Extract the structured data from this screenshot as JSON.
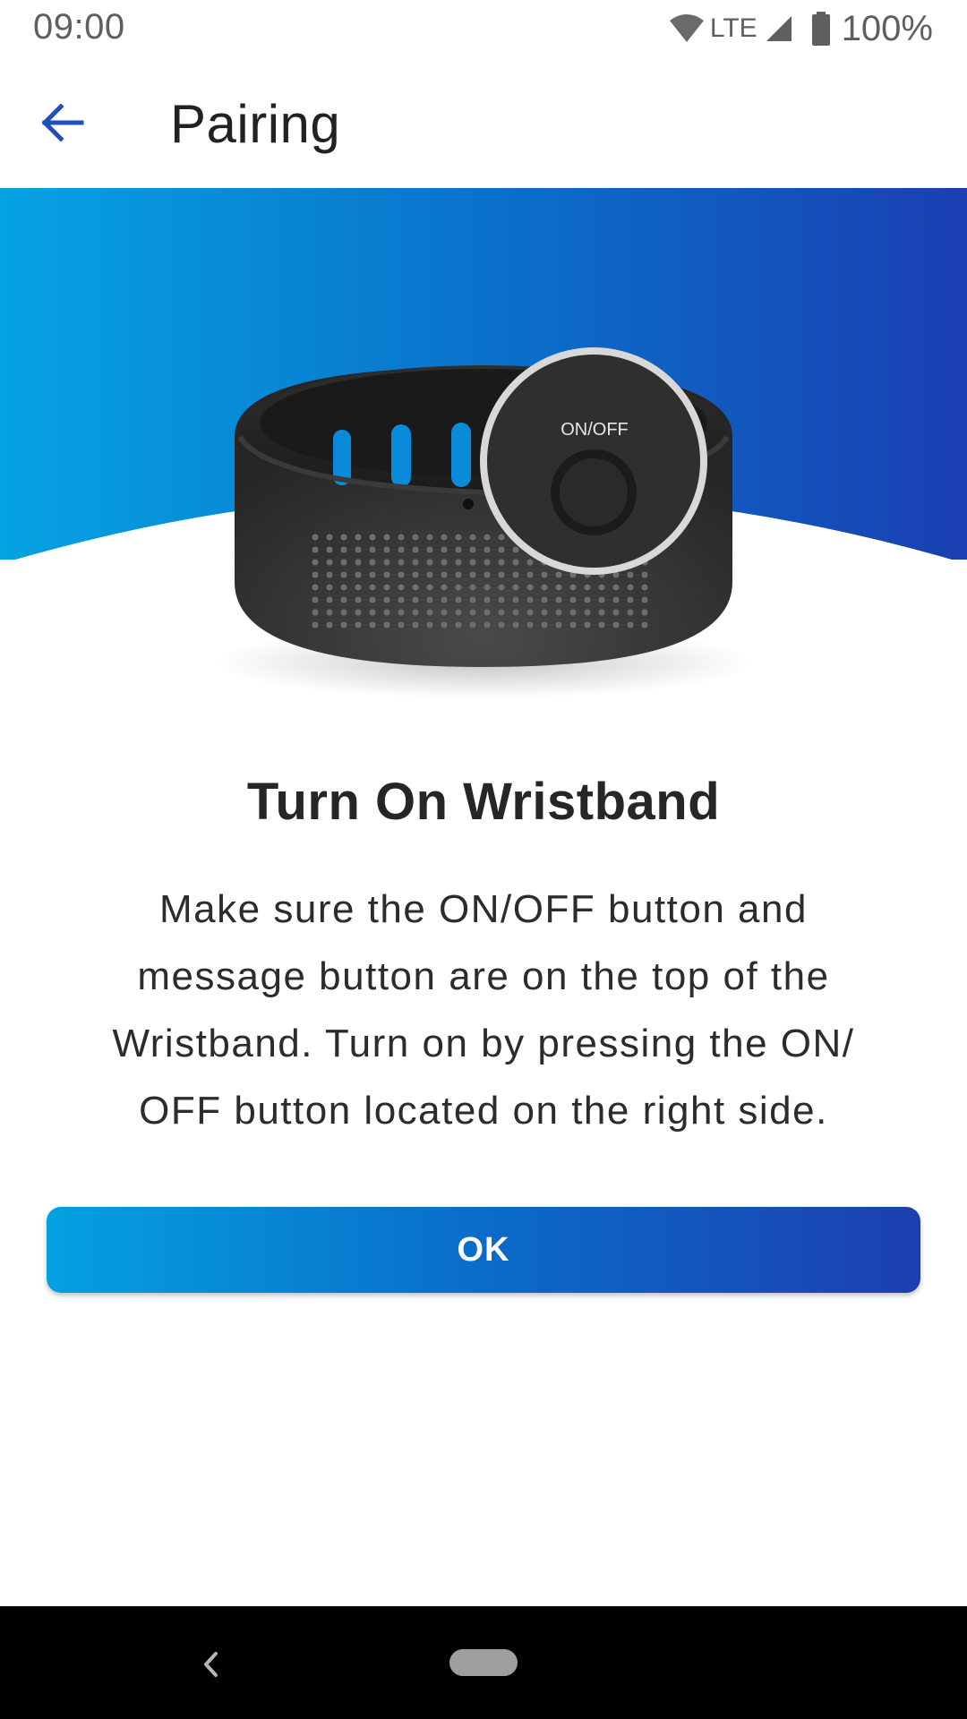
{
  "status_bar": {
    "time": "09:00",
    "network": "LTE",
    "battery": "100%"
  },
  "app_bar": {
    "title": "Pairing",
    "back_icon": "arrow-left-icon"
  },
  "hero": {
    "button_label": "ON/OFF",
    "icon": "wristband-illustration"
  },
  "content": {
    "heading": "Turn On Wristband",
    "description_lines": [
      "Make sure the ON/OFF button and",
      "message button are on the top of the",
      "Wristband. Turn on by pressing the ON/",
      "OFF button located on the right side."
    ],
    "ok_label": "OK"
  },
  "nav_bar": {
    "back_icon": "chevron-left-icon",
    "home_icon": "home-pill-icon"
  },
  "colors": {
    "accent_start": "#04a1e0",
    "accent_end": "#1d3fb0",
    "back_arrow": "#1e4fbf"
  }
}
